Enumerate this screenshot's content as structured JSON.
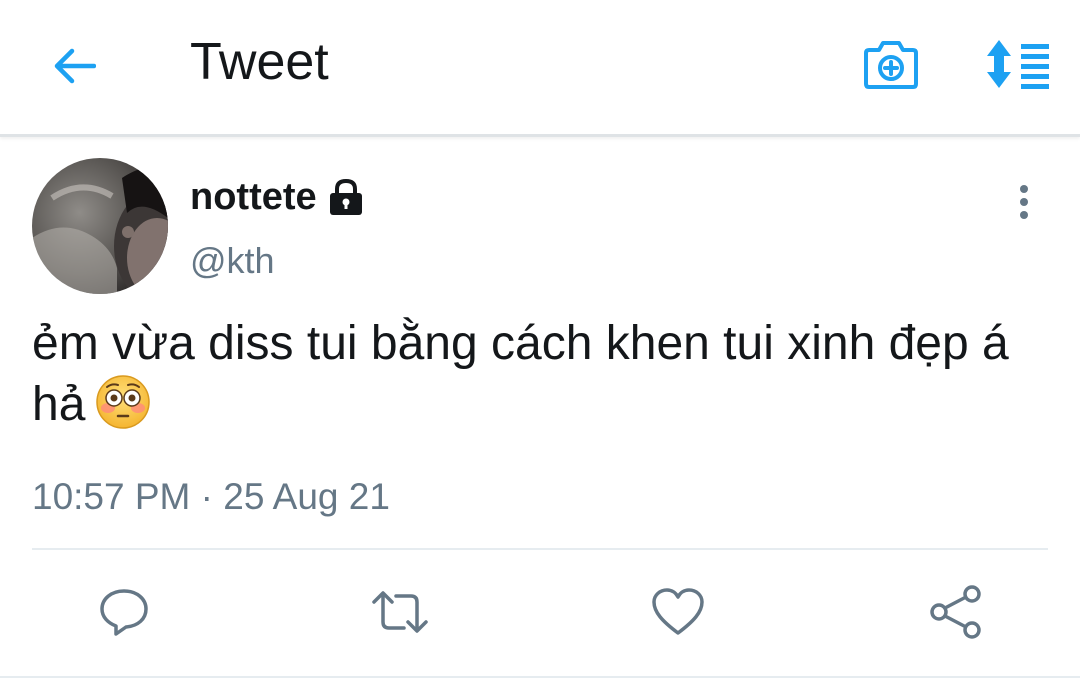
{
  "header": {
    "title": "Tweet",
    "back_icon": "arrow-left-icon",
    "camera_icon": "camera-plus-icon",
    "sort_icon": "sort-list-icon"
  },
  "tweet": {
    "author": {
      "display_name": "nottete",
      "handle": "@kth",
      "protected_icon": "lock-icon"
    },
    "text": "ẻm vừa diss tui bằng cách khen tui xinh đẹp á hả",
    "emoji": "flushed-face-emoji",
    "timestamp": "10:57 PM · 25 Aug 21"
  },
  "actions": {
    "reply": "reply-icon",
    "retweet": "retweet-icon",
    "like": "heart-icon",
    "share": "share-icon"
  },
  "colors": {
    "accent": "#1da1f2",
    "text": "#14171a",
    "muted": "#657786",
    "divider": "#e6ecf0"
  }
}
